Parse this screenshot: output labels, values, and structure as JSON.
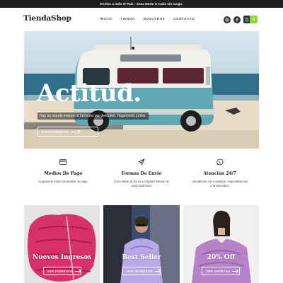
{
  "topbar": {
    "text": "Envios a todo el Pais - Zona Norte & Caba sin cargo."
  },
  "header": {
    "logo": "TiendaShop",
    "nav": [
      "INICIO",
      "TIENDA",
      "NOSOTROS",
      "CONTACTO"
    ],
    "cart_count": "0"
  },
  "hero": {
    "title": "Actitud.",
    "subtitle": "Hay un mundo enorme & hermoso por descubrir. Hagamoslo juntos.",
    "button": "EXPLOREMOS"
  },
  "features": [
    {
      "icon": "credit-card-icon",
      "title": "Medios De Pago",
      "desc": "Aceptamos todos los medios de pago."
    },
    {
      "icon": "send-icon",
      "title": "Formas De Envio",
      "desc": "Zona Norte de Bs As y Capital Federal sin cargo adicional."
    },
    {
      "icon": "whatsapp-icon",
      "title": "Atención 24/7",
      "desc": "Atendemos sus consultas, respondaremos a la brevedad."
    }
  ],
  "cards": [
    {
      "title": "Nuevos Ingresos",
      "button": "VER INGRESOS"
    },
    {
      "title": "Best Seller",
      "button": "VER INGRESOS"
    },
    {
      "title": "20% Off",
      "button": "VER OFERTAS"
    }
  ],
  "colors": {
    "accent": "#8bd63b",
    "topbar": "#1f1f1f",
    "van": "#5fa8b3"
  }
}
